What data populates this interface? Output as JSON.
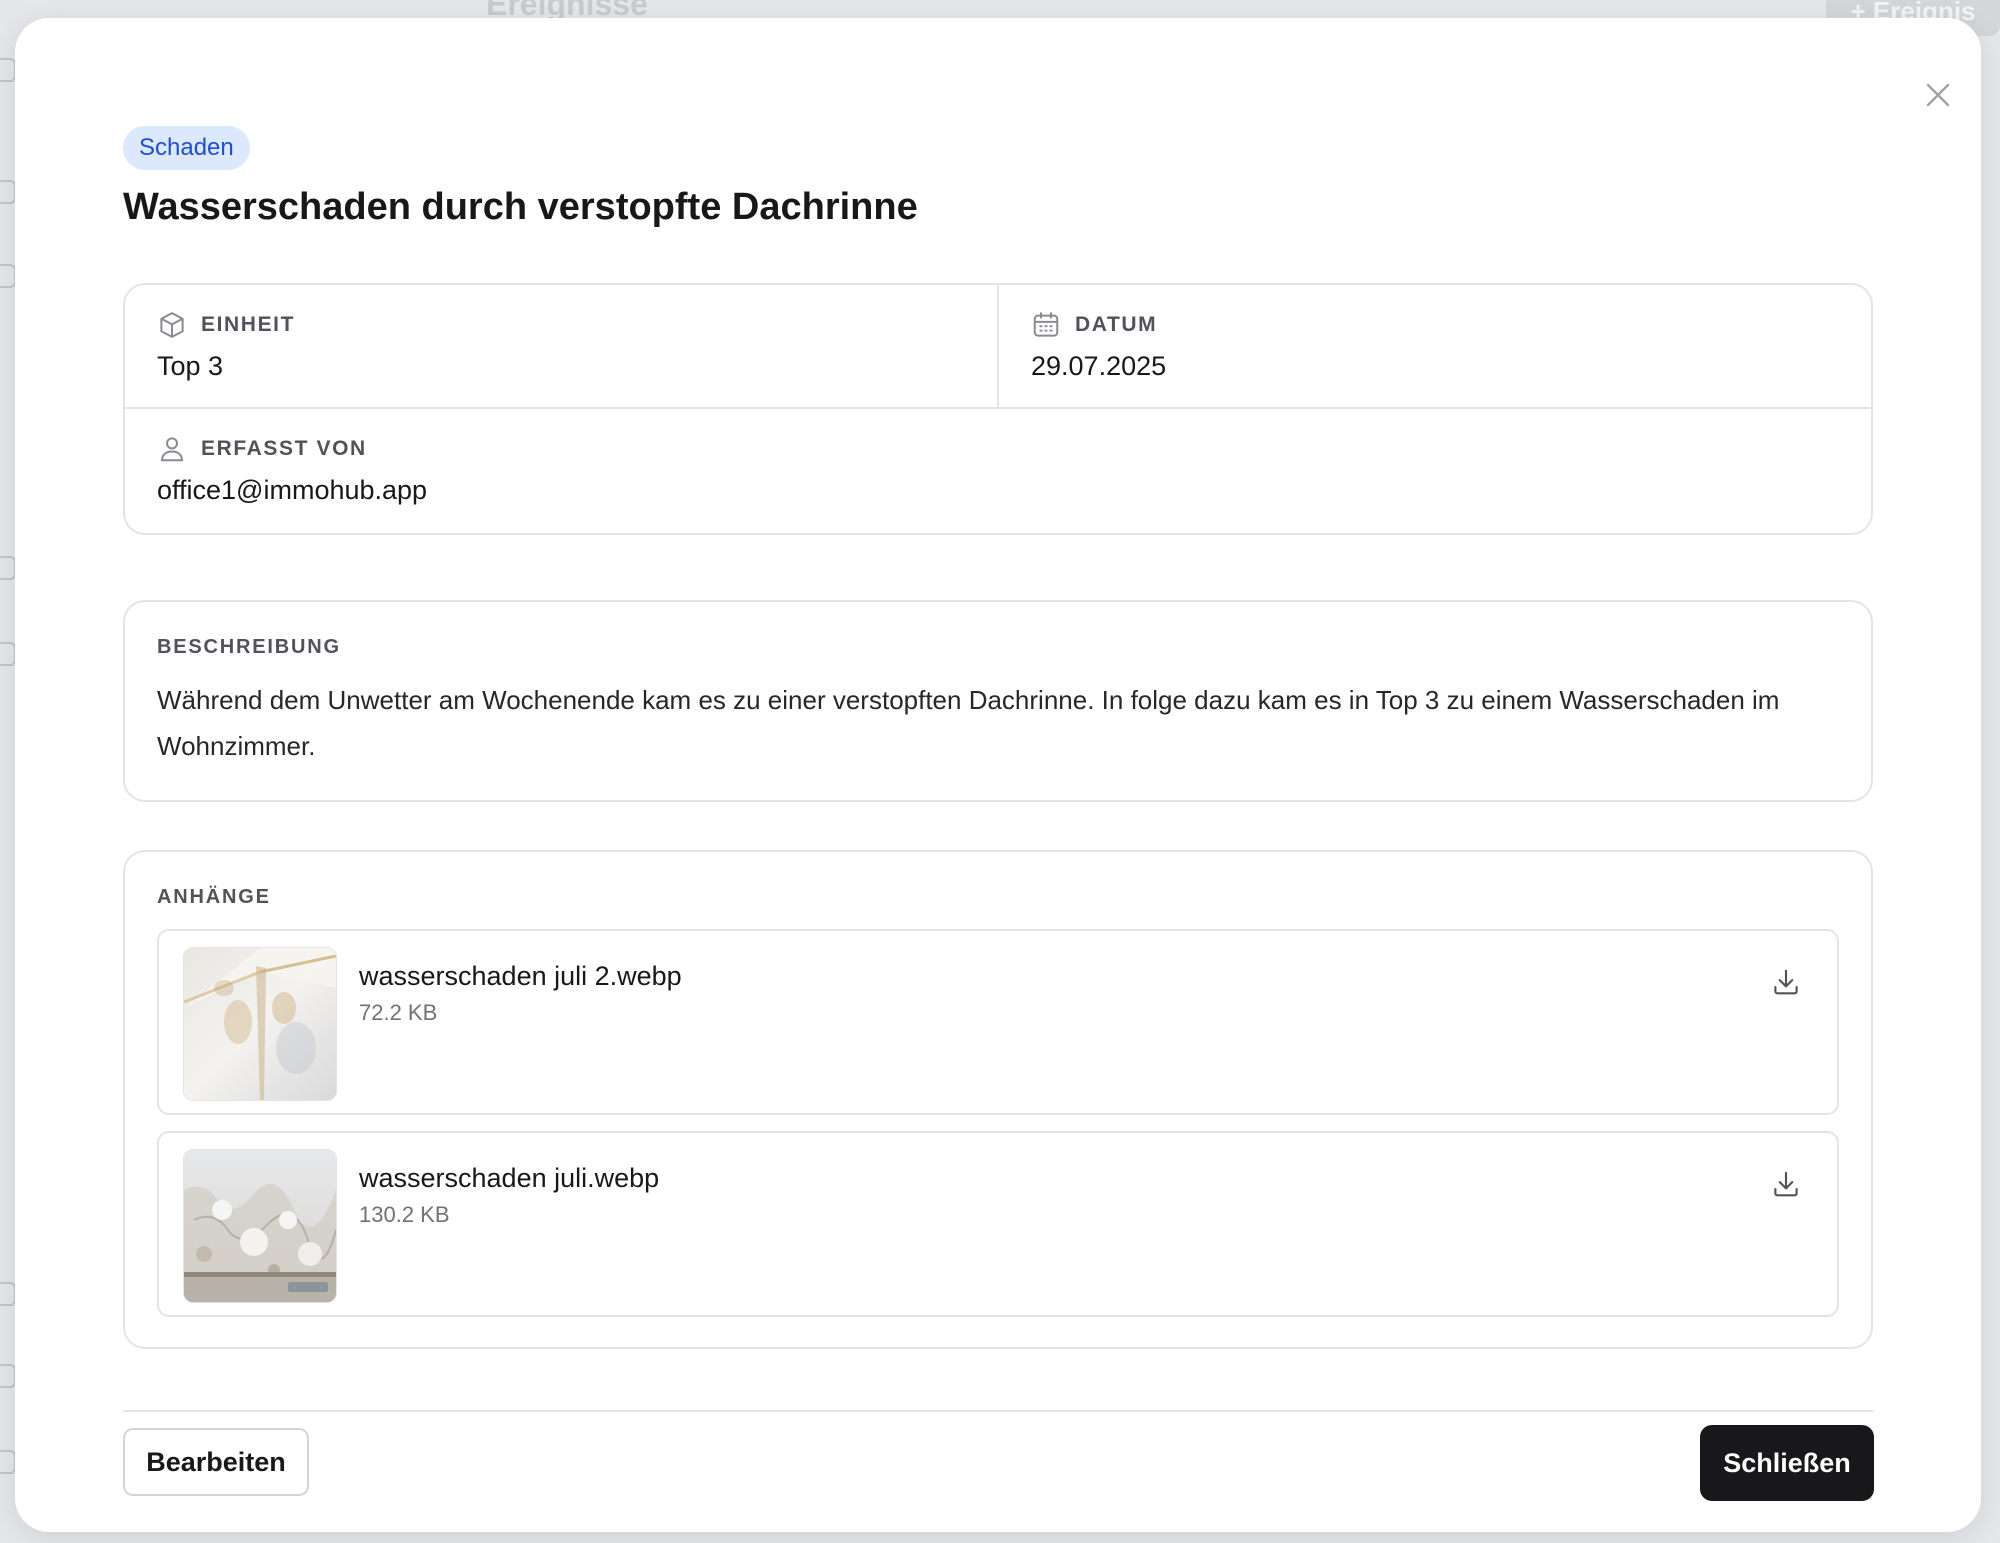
{
  "background": {
    "header_title": "Ereignisse",
    "header_button": "+ Ereignis"
  },
  "dialog": {
    "badge": "Schaden",
    "title": "Wasserschaden durch verstopfte Dachrinne",
    "meta": {
      "unit": {
        "label": "EINHEIT",
        "value": "Top 3",
        "icon": "cube-icon"
      },
      "date": {
        "label": "DATUM",
        "value": "29.07.2025",
        "icon": "calendar-icon"
      },
      "recorded_by": {
        "label": "ERFASST VON",
        "value": "office1@immohub.app",
        "icon": "user-icon"
      }
    },
    "description": {
      "label": "BESCHREIBUNG",
      "text": "Während dem Unwetter am Wochenende kam es zu einer verstopften Dachrinne. In folge dazu kam es in Top 3 zu einem Wasserschaden im Wohnzimmer."
    },
    "attachments": {
      "label": "ANHÄNGE",
      "items": [
        {
          "name": "wasserschaden juli 2.webp",
          "size": "72.2 KB"
        },
        {
          "name": "wasserschaden juli.webp",
          "size": "130.2 KB"
        }
      ]
    },
    "buttons": {
      "edit": "Bearbeiten",
      "close": "Schließen"
    }
  },
  "colors": {
    "accent_badge_bg": "#dbe8fd",
    "accent_badge_text": "#1d4ed8",
    "primary_button": "#18181b"
  }
}
